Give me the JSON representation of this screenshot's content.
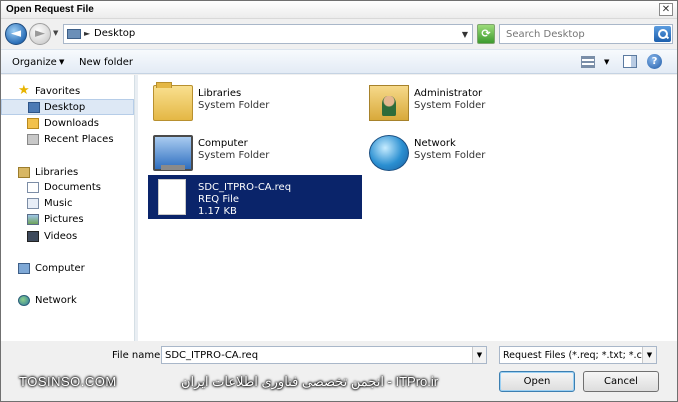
{
  "window": {
    "title": "Open Request File",
    "close_glyph": "✕"
  },
  "nav": {
    "back_glyph": "◄",
    "forward_glyph": "►",
    "dropdown_glyph": "▼"
  },
  "address": {
    "location": "Desktop",
    "separator_glyph": "►",
    "dropdown_glyph": "▼",
    "refresh_glyph": "⟳"
  },
  "search": {
    "placeholder": "Search Desktop"
  },
  "toolbar": {
    "organize_label": "Organize",
    "organize_arrow": "▼",
    "new_folder_label": "New folder",
    "views_arrow": "▼",
    "help_glyph": "?"
  },
  "sidebar": {
    "star_glyph": "★",
    "favorites": "Favorites",
    "desktop": "Desktop",
    "downloads": "Downloads",
    "recent_places": "Recent Places",
    "libraries": "Libraries",
    "documents": "Documents",
    "music": "Music",
    "pictures": "Pictures",
    "videos": "Videos",
    "computer": "Computer",
    "network": "Network"
  },
  "items": [
    {
      "name": "Libraries",
      "type": "System Folder"
    },
    {
      "name": "Administrator",
      "type": "System Folder"
    },
    {
      "name": "Computer",
      "type": "System Folder"
    },
    {
      "name": "Network",
      "type": "System Folder"
    },
    {
      "name": "SDC_ITPRO-CA.req",
      "type": "REQ File",
      "size": "1.17 KB"
    }
  ],
  "footer": {
    "file_name_label": "File name:",
    "file_name_value": "SDC_ITPRO-CA.req",
    "file_type_value": "Request Files (*.req; *.txt; *.cmc",
    "dropdown_glyph": "▼",
    "open_label": "Open",
    "cancel_label": "Cancel"
  },
  "watermark": {
    "left": "TOSINSO.COM",
    "middle": "انجمن تخصصی فناوری اطلاعات ایران - ITPro.ir"
  }
}
